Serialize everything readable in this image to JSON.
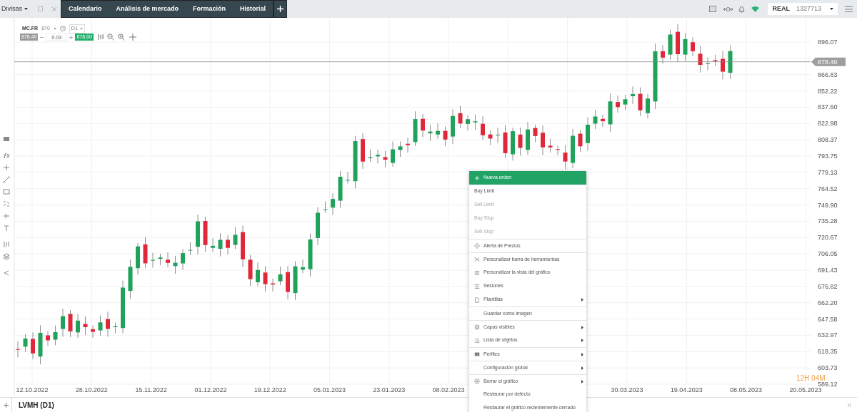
{
  "top_bar": {
    "instrument_tab": "Divisas",
    "tabs": [
      "Calendario",
      "Análisis de mercado",
      "Formación",
      "Historial"
    ],
    "account": {
      "mode": "REAL",
      "number": "1327713"
    }
  },
  "chart": {
    "symbol": "MC.FR",
    "symbol_note": "870",
    "timeframe": "D1",
    "sell_price": "878.40",
    "quantity": "0.03",
    "buy_price": "878.60",
    "current_price": "878.40",
    "countdown": "12H 04M",
    "price_axis": [
      "896.07",
      "866.83",
      "852.22",
      "837.60",
      "822.98",
      "808.37",
      "793.75",
      "779.13",
      "764.52",
      "749.90",
      "735.28",
      "720.67",
      "706.05",
      "691.43",
      "676.82",
      "662.20",
      "647.58",
      "632.97",
      "618.35",
      "603.73",
      "589.12"
    ],
    "time_axis": [
      "12.10.2022",
      "28.10.2022",
      "15.11.2022",
      "01.12.2022",
      "19.12.2022",
      "05.01.2023",
      "23.01.2023",
      "08.02.2023",
      "30.03.2023",
      "19.04.2023",
      "08.05.2023",
      "20.05.2023"
    ]
  },
  "context_menu": {
    "items": [
      {
        "label": "Nueva orden",
        "highlighted": true,
        "disabled": false,
        "submenu": false,
        "separator_before": false
      },
      {
        "label": "Buy Limit",
        "highlighted": false,
        "disabled": false,
        "submenu": false,
        "separator_before": false
      },
      {
        "label": "Sell Limit",
        "highlighted": false,
        "disabled": true,
        "submenu": false,
        "separator_before": false
      },
      {
        "label": "Buy Stop",
        "highlighted": false,
        "disabled": true,
        "submenu": false,
        "separator_before": false
      },
      {
        "label": "Sell Stop",
        "highlighted": false,
        "disabled": true,
        "submenu": false,
        "separator_before": false
      },
      {
        "label": "Alerta de Precios",
        "highlighted": false,
        "disabled": false,
        "submenu": false,
        "separator_before": true
      },
      {
        "label": "Personalizar barra de herramientas",
        "highlighted": false,
        "disabled": false,
        "submenu": false,
        "separator_before": true
      },
      {
        "label": "Personalizar la vista del gráfico",
        "highlighted": false,
        "disabled": false,
        "submenu": false,
        "separator_before": false
      },
      {
        "label": "Sesiones",
        "highlighted": false,
        "disabled": false,
        "submenu": false,
        "separator_before": false
      },
      {
        "label": "Plantillas",
        "highlighted": false,
        "disabled": false,
        "submenu": true,
        "separator_before": false
      },
      {
        "label": "Guardar como imagen",
        "highlighted": false,
        "disabled": false,
        "submenu": false,
        "separator_before": true
      },
      {
        "label": "Capas visibles",
        "highlighted": false,
        "disabled": false,
        "submenu": true,
        "separator_before": true
      },
      {
        "label": "Lista de objetos",
        "highlighted": false,
        "disabled": false,
        "submenu": true,
        "separator_before": false
      },
      {
        "label": "Perfiles",
        "highlighted": false,
        "disabled": false,
        "submenu": true,
        "separator_before": true
      },
      {
        "label": "Configuración global",
        "highlighted": false,
        "disabled": false,
        "submenu": true,
        "separator_before": true
      },
      {
        "label": "Borrar el gráfico",
        "highlighted": false,
        "disabled": false,
        "submenu": true,
        "separator_before": true
      },
      {
        "label": "Restaurar por defecto",
        "highlighted": false,
        "disabled": false,
        "submenu": false,
        "separator_before": false
      },
      {
        "label": "Restaurar el gráfico recientemente cerrado",
        "highlighted": false,
        "disabled": false,
        "submenu": false,
        "separator_before": false
      }
    ]
  },
  "bottom_bar": {
    "chart_tab": "LVMH (D1)"
  }
}
